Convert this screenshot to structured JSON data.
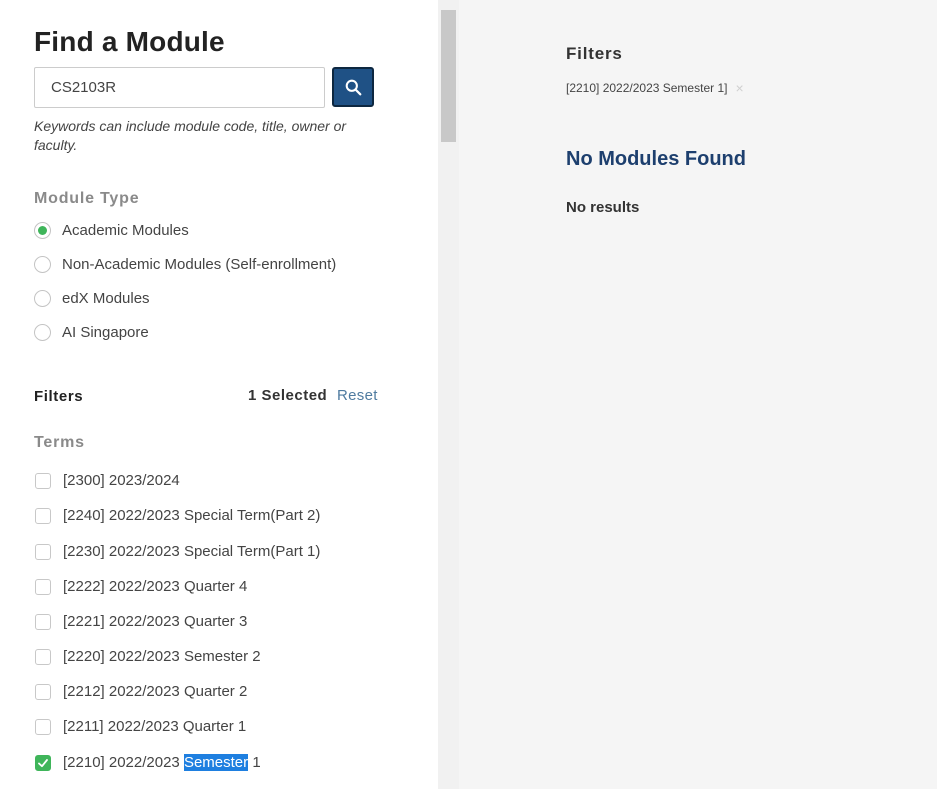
{
  "title": "Find a Module",
  "search": {
    "value": "CS2103R",
    "hint": "Keywords can include module code, title, owner or faculty."
  },
  "module_type": {
    "label": "Module Type",
    "options": [
      {
        "label": "Academic Modules",
        "checked": true
      },
      {
        "label": "Non-Academic Modules (Self-enrollment)",
        "checked": false
      },
      {
        "label": "edX Modules",
        "checked": false
      },
      {
        "label": "AI Singapore",
        "checked": false
      }
    ]
  },
  "filters": {
    "label": "Filters",
    "selected": "1 Selected",
    "reset": "Reset"
  },
  "terms": {
    "label": "Terms",
    "items": [
      {
        "label": "[2300] 2023/2024",
        "checked": false
      },
      {
        "label": "[2240] 2022/2023 Special Term(Part 2)",
        "checked": false
      },
      {
        "label": "[2230] 2022/2023 Special Term(Part 1)",
        "checked": false
      },
      {
        "label": "[2222] 2022/2023 Quarter 4",
        "checked": false
      },
      {
        "label": "[2221] 2022/2023 Quarter 3",
        "checked": false
      },
      {
        "label": "[2220] 2022/2023 Semester 2",
        "checked": false
      },
      {
        "label": "[2212] 2022/2023 Quarter 2",
        "checked": false
      },
      {
        "label": "[2211] 2022/2023 Quarter 1",
        "checked": false
      },
      {
        "label": "[2210] 2022/2023 Semester 1",
        "checked": true,
        "label_prefix": "[2210] 2022/2023 ",
        "label_highlight": "Semester",
        "label_suffix": " 1"
      }
    ]
  },
  "results": {
    "filters_title": "Filters",
    "active_filter": "[2210] 2022/2023 Semester 1]",
    "remove_icon": "×",
    "heading": "No Modules Found",
    "message": "No results"
  },
  "colors": {
    "accent": "#1f5185",
    "checked": "#3fb55a",
    "link": "#4f7ba0",
    "heading": "#1d3f6e",
    "selection": "#1e7fe0"
  }
}
